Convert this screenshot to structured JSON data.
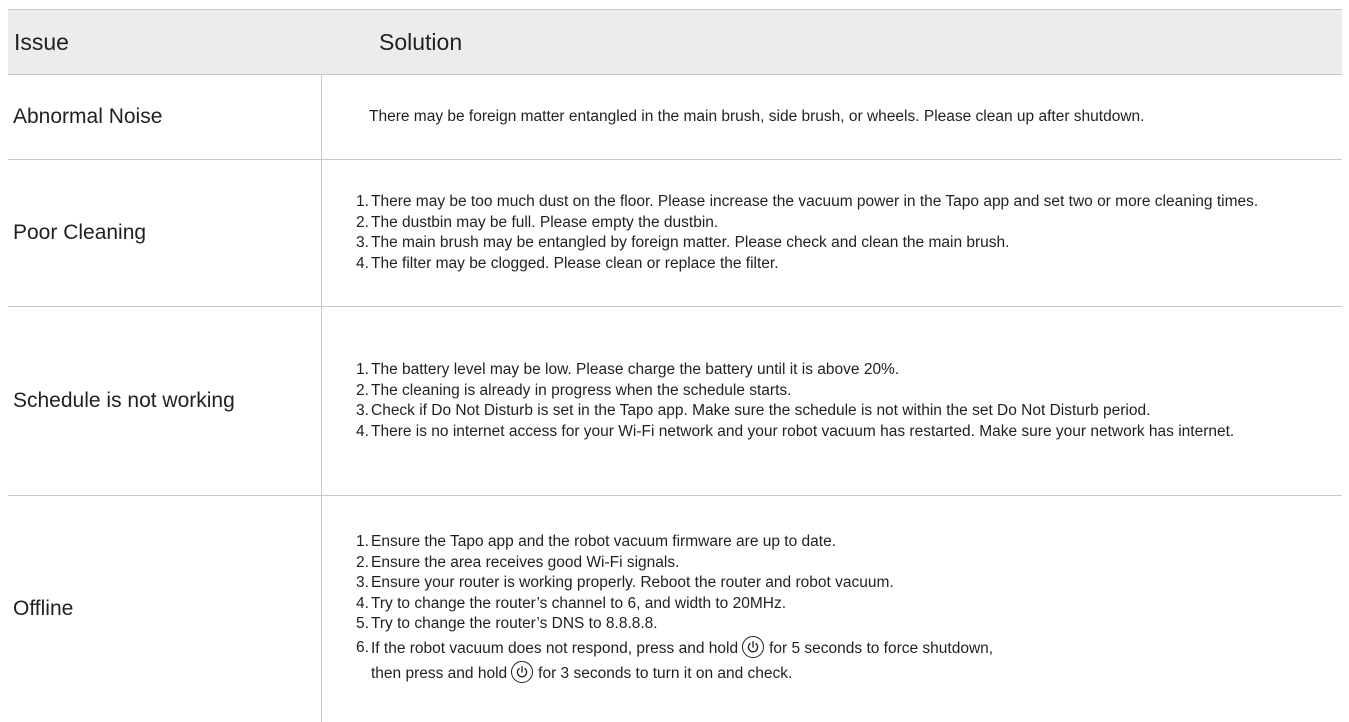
{
  "header": {
    "issue": "Issue",
    "solution": "Solution"
  },
  "rows": [
    {
      "issue": "Abnormal Noise",
      "solution": "There may be foreign matter entangled in the main brush, side brush, or wheels. Please clean up after shutdown."
    },
    {
      "issue": "Poor Cleaning",
      "items": [
        {
          "num": "1.",
          "text": "There may be too much dust on the floor. Please increase the vacuum power in the Tapo app and set two or more cleaning times."
        },
        {
          "num": "2.",
          "text": "The dustbin may be full. Please empty the dustbin."
        },
        {
          "num": "3.",
          "text": "The main brush may be entangled by foreign matter. Please check and clean the main brush."
        },
        {
          "num": "4.",
          "text": "The filter may be clogged. Please clean or replace the filter."
        }
      ]
    },
    {
      "issue": "Schedule is not working",
      "items": [
        {
          "num": "1.",
          "text": "The battery level may be low. Please charge the battery until it is above 20%."
        },
        {
          "num": "2.",
          "text": "The cleaning is already in progress when the schedule starts."
        },
        {
          "num": "3.",
          "text": "Check if Do Not Disturb is set in the Tapo app. Make sure the schedule is not within the set Do Not Disturb period."
        },
        {
          "num": "4.",
          "text": "There is no internet access for your Wi-Fi network and your robot vacuum has restarted. Make sure your network has internet."
        }
      ]
    },
    {
      "issue": "Offline",
      "items": [
        {
          "num": "1.",
          "text": "Ensure the Tapo app and the robot vacuum firmware are up to date."
        },
        {
          "num": "2.",
          "text": "Ensure the area receives good Wi-Fi signals."
        },
        {
          "num": "3.",
          "text": "Ensure your router is working properly. Reboot the router and robot vacuum."
        },
        {
          "num": "4.",
          "text": "Try to change the router’s channel to 6, and width to 20MHz."
        },
        {
          "num": "5.",
          "text": "Try to change the router’s DNS to 8.8.8.8."
        }
      ],
      "power_item": {
        "num": "6.",
        "part1": "If the robot vacuum does not respond, press and hold",
        "part2": "for 5 seconds to force shutdown,",
        "part3": "then press and hold",
        "part4": "for 3 seconds to turn it on and check.",
        "icon": "power-button-icon"
      }
    }
  ],
  "colors": {
    "text": "#231f20",
    "header_bg": "#ececec",
    "rule": "#c8c8c8"
  }
}
